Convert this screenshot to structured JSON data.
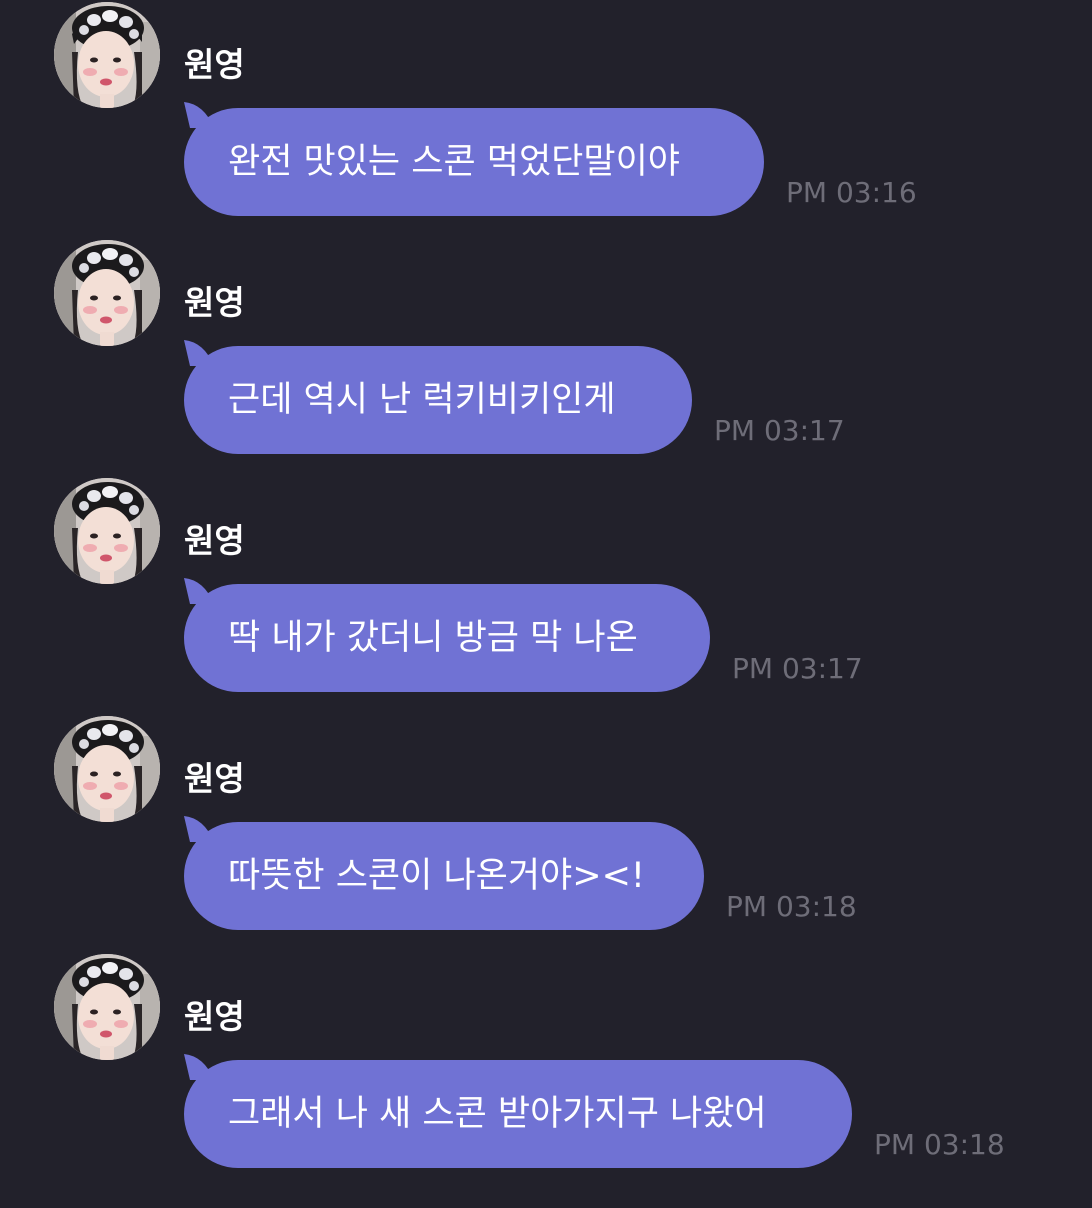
{
  "colors": {
    "background": "#22212b",
    "bubble": "#7072d4",
    "sender_text": "#ffffff",
    "message_text": "#ffffff",
    "timestamp_text": "#6e6d78"
  },
  "messages": [
    {
      "sender": "원영",
      "avatar_icon": "profile-photo-avatar",
      "text": "완전 맛있는 스콘 먹었단말이야",
      "time": "PM 03:16"
    },
    {
      "sender": "원영",
      "avatar_icon": "profile-photo-avatar",
      "text": "근데 역시 난 럭키비키인게",
      "time": "PM 03:17"
    },
    {
      "sender": "원영",
      "avatar_icon": "profile-photo-avatar",
      "text": "딱 내가 갔더니 방금 막 나온",
      "time": "PM 03:17"
    },
    {
      "sender": "원영",
      "avatar_icon": "profile-photo-avatar",
      "text": "따뜻한 스콘이 나온거야><!",
      "time": "PM 03:18"
    },
    {
      "sender": "원영",
      "avatar_icon": "profile-photo-avatar",
      "text": "그래서 나 새 스콘 받아가지구 나왔어",
      "time": "PM 03:18"
    }
  ]
}
